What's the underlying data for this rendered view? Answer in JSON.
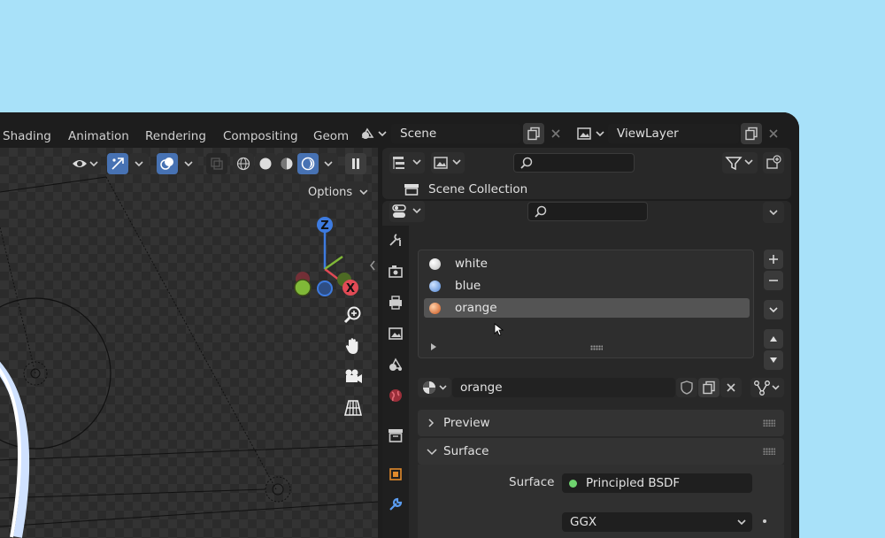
{
  "workspace_tabs": [
    "Shading",
    "Animation",
    "Rendering",
    "Compositing",
    "Geom"
  ],
  "scene": {
    "label": "Scene"
  },
  "view_layer": {
    "label": "ViewLayer"
  },
  "viewport": {
    "options_label": "Options",
    "gizmo": {
      "z": "Z",
      "x": "X"
    }
  },
  "outliner": {
    "scene_collection": "Scene Collection",
    "search_value": ""
  },
  "properties": {
    "search_value": "",
    "material_slots": [
      {
        "name": "white",
        "color": "#e8e8e8",
        "selected": false
      },
      {
        "name": "blue",
        "color": "#7fb1f0",
        "selected": false
      },
      {
        "name": "orange",
        "color": "#e07a3e",
        "selected": true
      }
    ],
    "material_name": "orange",
    "sections": {
      "preview": "Preview",
      "surface": "Surface"
    },
    "surface_label": "Surface",
    "surface_value": "Principled BSDF",
    "distribution_value": "GGX"
  },
  "colors": {
    "background": "#a8e1f9",
    "accent": "#4772b3",
    "axis_z": "#3d7be0",
    "axis_x": "#e14a55",
    "axis_y": "#80b838",
    "surface_dot": "#6fd36f"
  }
}
